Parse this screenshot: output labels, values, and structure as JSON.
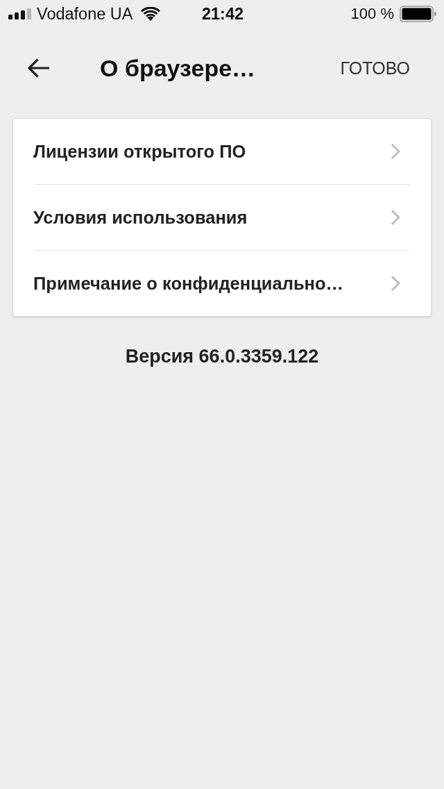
{
  "status_bar": {
    "carrier": "Vodafone UA",
    "time": "21:42",
    "battery": "100 %"
  },
  "nav_bar": {
    "title": "О браузере…",
    "done": "ГОТОВО"
  },
  "menu": [
    {
      "label": "Лицензии открытого ПО"
    },
    {
      "label": "Условия использования"
    },
    {
      "label": "Примечание о конфиденциально…"
    }
  ],
  "version": "Версия 66.0.3359.122"
}
